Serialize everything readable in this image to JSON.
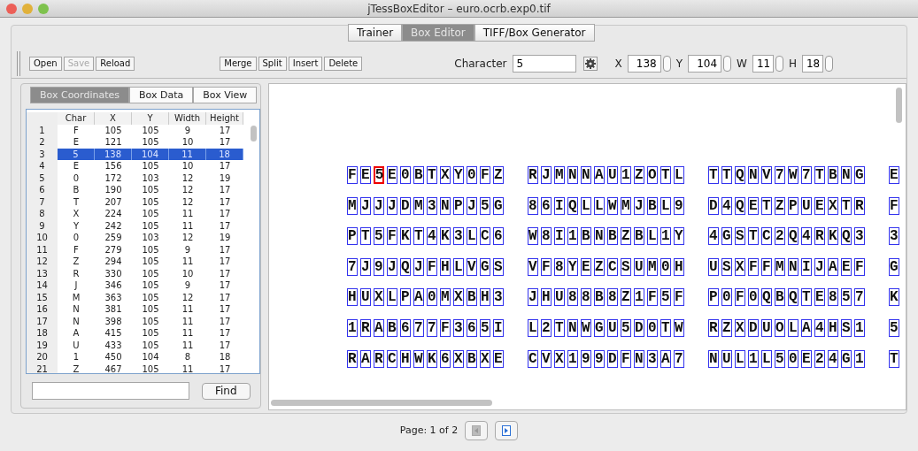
{
  "window": {
    "title": "jTessBoxEditor – euro.ocrb.exp0.tif"
  },
  "main_tabs": [
    {
      "label": "Trainer",
      "selected": false
    },
    {
      "label": "Box Editor",
      "selected": true
    },
    {
      "label": "TIFF/Box Generator",
      "selected": false
    }
  ],
  "toolbar": {
    "file_buttons": [
      {
        "label": "Open",
        "disabled": false
      },
      {
        "label": "Save",
        "disabled": true
      },
      {
        "label": "Reload",
        "disabled": false
      }
    ],
    "edit_buttons": [
      {
        "label": "Merge",
        "disabled": false
      },
      {
        "label": "Split",
        "disabled": false
      },
      {
        "label": "Insert",
        "disabled": false
      },
      {
        "label": "Delete",
        "disabled": false
      }
    ],
    "character": {
      "label": "Character",
      "value": "5"
    },
    "coords": [
      {
        "label": "X",
        "value": "138"
      },
      {
        "label": "Y",
        "value": "104"
      },
      {
        "label": "W",
        "value": "11"
      },
      {
        "label": "H",
        "value": "18"
      }
    ]
  },
  "side_tabs": [
    {
      "label": "Box Coordinates",
      "selected": true
    },
    {
      "label": "Box Data",
      "selected": false
    },
    {
      "label": "Box View",
      "selected": false
    }
  ],
  "box_table": {
    "columns": [
      "Char",
      "X",
      "Y",
      "Width",
      "Height"
    ],
    "rows": [
      {
        "index": "1",
        "cells": [
          "F",
          "105",
          "105",
          "9",
          "17"
        ],
        "selected": false
      },
      {
        "index": "2",
        "cells": [
          "E",
          "121",
          "105",
          "10",
          "17"
        ],
        "selected": false
      },
      {
        "index": "3",
        "cells": [
          "5",
          "138",
          "104",
          "11",
          "18"
        ],
        "selected": true
      },
      {
        "index": "4",
        "cells": [
          "E",
          "156",
          "105",
          "10",
          "17"
        ],
        "selected": false
      },
      {
        "index": "5",
        "cells": [
          "0",
          "172",
          "103",
          "12",
          "19"
        ],
        "selected": false
      },
      {
        "index": "6",
        "cells": [
          "B",
          "190",
          "105",
          "12",
          "17"
        ],
        "selected": false
      },
      {
        "index": "7",
        "cells": [
          "T",
          "207",
          "105",
          "12",
          "17"
        ],
        "selected": false
      },
      {
        "index": "8",
        "cells": [
          "X",
          "224",
          "105",
          "11",
          "17"
        ],
        "selected": false
      },
      {
        "index": "9",
        "cells": [
          "Y",
          "242",
          "105",
          "11",
          "17"
        ],
        "selected": false
      },
      {
        "index": "10",
        "cells": [
          "0",
          "259",
          "103",
          "12",
          "19"
        ],
        "selected": false
      },
      {
        "index": "11",
        "cells": [
          "F",
          "279",
          "105",
          "9",
          "17"
        ],
        "selected": false
      },
      {
        "index": "12",
        "cells": [
          "Z",
          "294",
          "105",
          "11",
          "17"
        ],
        "selected": false
      },
      {
        "index": "13",
        "cells": [
          "R",
          "330",
          "105",
          "10",
          "17"
        ],
        "selected": false
      },
      {
        "index": "14",
        "cells": [
          "J",
          "346",
          "105",
          "9",
          "17"
        ],
        "selected": false
      },
      {
        "index": "15",
        "cells": [
          "M",
          "363",
          "105",
          "12",
          "17"
        ],
        "selected": false
      },
      {
        "index": "16",
        "cells": [
          "N",
          "381",
          "105",
          "11",
          "17"
        ],
        "selected": false
      },
      {
        "index": "17",
        "cells": [
          "N",
          "398",
          "105",
          "11",
          "17"
        ],
        "selected": false
      },
      {
        "index": "18",
        "cells": [
          "A",
          "415",
          "105",
          "11",
          "17"
        ],
        "selected": false
      },
      {
        "index": "19",
        "cells": [
          "U",
          "433",
          "105",
          "11",
          "17"
        ],
        "selected": false
      },
      {
        "index": "20",
        "cells": [
          "1",
          "450",
          "104",
          "8",
          "18"
        ],
        "selected": false
      },
      {
        "index": "21",
        "cells": [
          "Z",
          "467",
          "105",
          "11",
          "17"
        ],
        "selected": false
      }
    ]
  },
  "find": {
    "button": "Find"
  },
  "image": {
    "lines": [
      [
        [
          "F",
          "E",
          "5",
          "E",
          "0",
          "B",
          "T",
          "X",
          "Y",
          "0",
          "F",
          "Z"
        ],
        [
          "R",
          "J",
          "M",
          "N",
          "N",
          "A",
          "U",
          "1",
          "Z",
          "O",
          "T",
          "L"
        ],
        [
          "T",
          "T",
          "Q",
          "N",
          "V",
          "7",
          "W",
          "7",
          "T",
          "B",
          "N",
          "G"
        ],
        [
          "E"
        ]
      ],
      [
        [
          "M",
          "J",
          "J",
          "J",
          "D",
          "M",
          "3",
          "N",
          "P",
          "J",
          "5",
          "G"
        ],
        [
          "8",
          "6",
          "I",
          "Q",
          "L",
          "L",
          "W",
          "M",
          "J",
          "B",
          "L",
          "9"
        ],
        [
          "D",
          "4",
          "Q",
          "E",
          "T",
          "Z",
          "P",
          "U",
          "E",
          "X",
          "T",
          "R"
        ],
        [
          "F"
        ]
      ],
      [
        [
          "P",
          "T",
          "5",
          "F",
          "K",
          "T",
          "4",
          "K",
          "3",
          "L",
          "C",
          "6"
        ],
        [
          "W",
          "8",
          "I",
          "1",
          "B",
          "N",
          "B",
          "Z",
          "B",
          "L",
          "1",
          "Y"
        ],
        [
          "4",
          "G",
          "S",
          "T",
          "C",
          "2",
          "Q",
          "4",
          "R",
          "K",
          "Q",
          "3"
        ],
        [
          "3"
        ]
      ],
      [
        [
          "7",
          "J",
          "9",
          "J",
          "Q",
          "J",
          "F",
          "H",
          "L",
          "V",
          "G",
          "S"
        ],
        [
          "V",
          "F",
          "8",
          "Y",
          "E",
          "Z",
          "C",
          "S",
          "U",
          "M",
          "0",
          "H"
        ],
        [
          "U",
          "S",
          "X",
          "F",
          "F",
          "M",
          "N",
          "I",
          "J",
          "A",
          "E",
          "F"
        ],
        [
          "G"
        ]
      ],
      [
        [
          "H",
          "U",
          "X",
          "L",
          "P",
          "A",
          "0",
          "M",
          "X",
          "B",
          "H",
          "3"
        ],
        [
          "J",
          "H",
          "U",
          "8",
          "8",
          "B",
          "8",
          "Z",
          "1",
          "F",
          "5",
          "F"
        ],
        [
          "P",
          "0",
          "F",
          "0",
          "Q",
          "B",
          "Q",
          "T",
          "E",
          "8",
          "5",
          "7"
        ],
        [
          "K"
        ]
      ],
      [
        [
          "1",
          "R",
          "A",
          "B",
          "6",
          "7",
          "7",
          "F",
          "3",
          "6",
          "5",
          "I"
        ],
        [
          "L",
          "2",
          "T",
          "N",
          "W",
          "G",
          "U",
          "5",
          "D",
          "0",
          "T",
          "W"
        ],
        [
          "R",
          "Z",
          "X",
          "D",
          "U",
          "O",
          "L",
          "A",
          "4",
          "H",
          "S",
          "1"
        ],
        [
          "5"
        ]
      ],
      [
        [
          "R",
          "A",
          "R",
          "C",
          "H",
          "W",
          "K",
          "6",
          "X",
          "B",
          "X",
          "E"
        ],
        [
          "C",
          "V",
          "X",
          "1",
          "9",
          "9",
          "D",
          "F",
          "N",
          "3",
          "A",
          "7"
        ],
        [
          "N",
          "U",
          "L",
          "1",
          "L",
          "5",
          "0",
          "E",
          "2",
          "4",
          "G",
          "1"
        ],
        [
          "T"
        ]
      ]
    ]
  },
  "pager": {
    "text": "Page: 1 of 2",
    "prev_disabled": true,
    "next_disabled": false
  }
}
